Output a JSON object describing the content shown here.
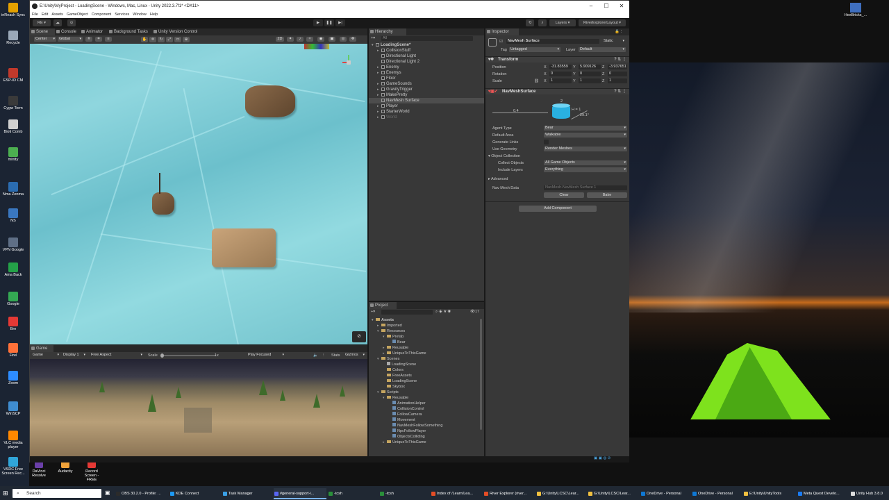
{
  "desktop": {
    "left_icons": [
      {
        "label": "inReach Sync",
        "color": "#e4a100"
      },
      {
        "label": "Recycle",
        "color": "#9aa8b8"
      },
      {
        "label": "ESP-ID CM",
        "color": "#c0392b"
      },
      {
        "label": "Cygw Term",
        "color": "#3a3a3a"
      },
      {
        "label": "Bioti Comb",
        "color": "#d0d0d0"
      },
      {
        "label": "mintty",
        "color": "#4caf50"
      },
      {
        "label": "Nma Zenma",
        "color": "#2b6cb0"
      },
      {
        "label": "NS",
        "color": "#3a77bf"
      },
      {
        "label": "VPN Google",
        "color": "#5f6f86"
      },
      {
        "label": "Ama Back",
        "color": "#24a148"
      },
      {
        "label": "Google",
        "color": "#34a853"
      },
      {
        "label": "Bre",
        "color": "#e53935"
      },
      {
        "label": "Firel",
        "color": "#ff7139"
      },
      {
        "label": "Zoom",
        "color": "#2d8cff"
      },
      {
        "label": "WinSCP",
        "color": "#3f8ccf"
      },
      {
        "label": "VLC media player",
        "color": "#ff8800"
      },
      {
        "label": "VSDC Free Screen Rec...",
        "color": "#30a5d8"
      }
    ],
    "right_icon": {
      "label": "HexBricks_...",
      "color": "#3f6fbf"
    },
    "quick_launch": [
      {
        "label": "DaVinci Resolve",
        "color": "#6a3fa8"
      },
      {
        "label": "Audacity",
        "color": "#f1a33a"
      },
      {
        "label": "Record Screen - FREE",
        "color": "#e53935"
      }
    ]
  },
  "unity": {
    "title": "E:\\Unity\\MyProject - LoadingScene - Windows, Mac, Linux - Unity 2022.3.7f1* <DX11>",
    "menu": [
      "File",
      "Edit",
      "Assets",
      "GameObject",
      "Component",
      "Services",
      "Window",
      "Help"
    ],
    "toolbar": {
      "account": "RE",
      "layers": "Layers",
      "layout": "RiverExplorerLayout"
    },
    "scene_tabs": [
      {
        "label": "Scene",
        "active": true
      },
      {
        "label": "Console",
        "active": false
      },
      {
        "label": "Animator",
        "active": false
      },
      {
        "label": "Background Tasks",
        "active": false
      },
      {
        "label": "Unity Version Control",
        "active": false
      }
    ],
    "scene_toolbar": {
      "pivot": "Center",
      "space": "Global",
      "mode2d": "2D"
    },
    "game": {
      "tab": "Game",
      "mode": "Game",
      "display": "Display 1",
      "aspect": "Free Aspect",
      "scale_label": "Scale",
      "scale_value": "1x",
      "play_focused": "Play Focused",
      "stats": "Stats",
      "gizmos": "Gizmos"
    },
    "hierarchy": {
      "tab": "Hierarchy",
      "search_placeholder": "All",
      "items": [
        {
          "label": "LoadingScene*",
          "depth": 0,
          "bold": true,
          "arrow": "▾"
        },
        {
          "label": "CollisionStuff",
          "depth": 1,
          "arrow": "▸"
        },
        {
          "label": "Directional Light",
          "depth": 1,
          "arrow": ""
        },
        {
          "label": "Directional Light 2",
          "depth": 1,
          "arrow": ""
        },
        {
          "label": "Enemy",
          "depth": 1,
          "arrow": "▸"
        },
        {
          "label": "Enemys",
          "depth": 1,
          "arrow": "▸"
        },
        {
          "label": "Floor",
          "depth": 1,
          "arrow": ""
        },
        {
          "label": "GameSounds",
          "depth": 1,
          "arrow": "▸"
        },
        {
          "label": "GravityTrigger",
          "depth": 1,
          "arrow": "▸"
        },
        {
          "label": "MakePretty",
          "depth": 1,
          "arrow": "▸"
        },
        {
          "label": "NavMesh Surface",
          "depth": 1,
          "arrow": "",
          "selected": true
        },
        {
          "label": "Player",
          "depth": 1,
          "arrow": "▸"
        },
        {
          "label": "StarterWorld",
          "depth": 1,
          "arrow": "▸"
        },
        {
          "label": "World",
          "depth": 1,
          "arrow": "▸",
          "dim": true
        }
      ]
    },
    "project": {
      "tab": "Project",
      "count": "17",
      "items": [
        {
          "label": "Assets",
          "depth": 0,
          "type": "folder",
          "arrow": "▾",
          "bold": true
        },
        {
          "label": "Imported",
          "depth": 1,
          "type": "folder",
          "arrow": "▸"
        },
        {
          "label": "Resources",
          "depth": 1,
          "type": "folder",
          "arrow": "▾"
        },
        {
          "label": "Prefab",
          "depth": 2,
          "type": "folder",
          "arrow": "▾"
        },
        {
          "label": "Bear",
          "depth": 3,
          "type": "prefab",
          "arrow": ""
        },
        {
          "label": "Reusable",
          "depth": 2,
          "type": "folder",
          "arrow": "▸"
        },
        {
          "label": "UniqueToThisGame",
          "depth": 2,
          "type": "folder",
          "arrow": "▸"
        },
        {
          "label": "Scenes",
          "depth": 1,
          "type": "folder",
          "arrow": "▾"
        },
        {
          "label": "LoadingScene",
          "depth": 2,
          "type": "scene",
          "arrow": ""
        },
        {
          "label": "Colors",
          "depth": 2,
          "type": "folder",
          "arrow": ""
        },
        {
          "label": "FreeAssets",
          "depth": 2,
          "type": "folder",
          "arrow": ""
        },
        {
          "label": "LoadingScene",
          "depth": 2,
          "type": "folder",
          "arrow": ""
        },
        {
          "label": "Skybox",
          "depth": 2,
          "type": "folder",
          "arrow": ""
        },
        {
          "label": "Scripts",
          "depth": 1,
          "type": "folder",
          "arrow": "▾"
        },
        {
          "label": "Reusable",
          "depth": 2,
          "type": "folder",
          "arrow": "▾"
        },
        {
          "label": "AnimationHelper",
          "depth": 3,
          "type": "script",
          "arrow": ""
        },
        {
          "label": "CollisionControl",
          "depth": 3,
          "type": "script",
          "arrow": ""
        },
        {
          "label": "FollowCamera",
          "depth": 3,
          "type": "script",
          "arrow": ""
        },
        {
          "label": "Movement",
          "depth": 3,
          "type": "script",
          "arrow": ""
        },
        {
          "label": "NavMeshFollowSomething",
          "depth": 3,
          "type": "script",
          "arrow": ""
        },
        {
          "label": "NpcFollowPlayer",
          "depth": 3,
          "type": "script",
          "arrow": ""
        },
        {
          "label": "ObjectsColliding",
          "depth": 3,
          "type": "script",
          "arrow": ""
        },
        {
          "label": "UniqueToThisGame",
          "depth": 2,
          "type": "folder",
          "arrow": "▸"
        }
      ]
    },
    "inspector": {
      "tab": "Inspector",
      "object_name": "NavMesh Surface",
      "static_label": "Static",
      "tag_label": "Tag",
      "tag_value": "Untagged",
      "layer_label": "Layer",
      "layer_value": "Default",
      "transform": {
        "title": "Transform",
        "position_label": "Position",
        "rotation_label": "Rotation",
        "scale_label": "Scale",
        "position": {
          "x": "-31.83559",
          "y": "5.909126",
          "z": "-3.937651"
        },
        "rotation": {
          "x": "0",
          "y": "0",
          "z": "0"
        },
        "scale": {
          "x": "1",
          "y": "1",
          "z": "1"
        }
      },
      "navmesh": {
        "title": "NavMeshSurface",
        "diagram_r": "0.4",
        "diagram_h": "2",
        "diagram_hs": "H = 1",
        "diagram_angle": "29.1°",
        "agent_type_label": "Agent Type",
        "agent_type": "Bear",
        "default_area_label": "Default Area",
        "default_area": "Walkable",
        "generate_links_label": "Generate Links",
        "use_geometry_label": "Use Geometry",
        "use_geometry": "Render Meshes",
        "object_collection_label": "Object Collection",
        "collect_objects_label": "Collect Objects",
        "collect_objects": "All Game Objects",
        "include_layers_label": "Include Layers",
        "include_layers": "Everything",
        "advanced_label": "Advanced",
        "navmesh_data_label": "Nav Mesh Data",
        "navmesh_data": "NavMesh-NavMesh Surface 1",
        "clear_button": "Clear",
        "bake_button": "Bake"
      },
      "add_component": "Add Component"
    }
  },
  "taskbar": {
    "search_placeholder": "Search",
    "items": [
      {
        "label": "OBS 30.2.0 - Profile: ...",
        "color": "#2b2b2b",
        "active": false
      },
      {
        "label": "KDE Connect",
        "color": "#1d99f3",
        "active": false
      },
      {
        "label": "Task Manager",
        "color": "#3aa0e6",
        "active": false
      },
      {
        "label": "#general-support-i...",
        "color": "#5865f2",
        "active": true
      },
      {
        "label": "-tcsh",
        "color": "#2a8f3a",
        "active": false
      },
      {
        "label": "-tcsh",
        "color": "#2a8f3a",
        "active": false
      },
      {
        "label": "Index of /Learn/Lea...",
        "color": "#e44d26",
        "active": false
      },
      {
        "label": "River Explorer (river...",
        "color": "#e44d26",
        "active": false
      },
      {
        "label": "G:\\Unity\\LCSC\\Lear...",
        "color": "#f0c040",
        "active": false
      },
      {
        "label": "G:\\Unity\\LCSC\\Lear...",
        "color": "#f0c040",
        "active": false
      },
      {
        "label": "OneDrive - Personal",
        "color": "#0f78d4",
        "active": false
      },
      {
        "label": "OneDrive - Personal",
        "color": "#0f78d4",
        "active": false
      },
      {
        "label": "E:\\Unity\\UnityTools",
        "color": "#f0c040",
        "active": false
      },
      {
        "label": "Meta Quest Develo...",
        "color": "#1a7cf5",
        "active": false
      },
      {
        "label": "Unity Hub 3.8.0",
        "color": "#dddddd",
        "active": false
      }
    ]
  }
}
